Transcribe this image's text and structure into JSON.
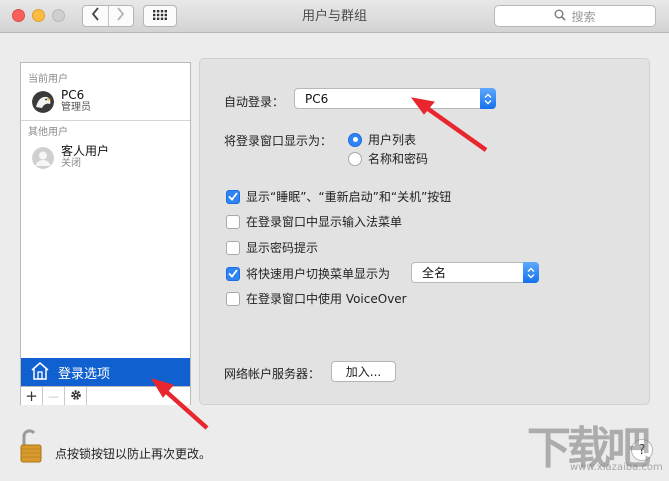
{
  "window": {
    "title": "用户与群组"
  },
  "search": {
    "placeholder": "搜索"
  },
  "icons": {
    "back": "chevron-left-icon",
    "forward": "chevron-right-icon",
    "show_all": "grid-icon",
    "search": "magnifier-icon",
    "lock": "lock-open-icon",
    "help": "help-icon",
    "home": "house-icon",
    "gear": "gear-icon"
  },
  "colors": {
    "selection": "#1061cf",
    "accent": "#2f84f3",
    "annotation_arrow": "#e8262d"
  },
  "sidebar": {
    "current_users_header": "当前用户",
    "current_user": {
      "name": "PC6",
      "role": "管理员"
    },
    "other_users_header": "其他用户",
    "guest_user": {
      "name": "客人用户",
      "status": "关闭"
    },
    "login_options_label": "登录选项",
    "toolbar": {
      "add": "+",
      "remove": "—"
    }
  },
  "panel": {
    "auto_login": {
      "label": "自动登录：",
      "value": "PC6"
    },
    "display_as": {
      "label": "将登录窗口显示为：",
      "options": [
        {
          "label": "用户列表",
          "selected": true
        },
        {
          "label": "名称和密码",
          "selected": false
        }
      ]
    },
    "checkboxes": [
      {
        "label": "显示“睡眠”、“重新启动”和“关机”按钮",
        "checked": true
      },
      {
        "label": "在登录窗口中显示输入法菜单",
        "checked": false
      },
      {
        "label": "显示密码提示",
        "checked": false
      },
      {
        "label": "将快速用户切换菜单显示为",
        "checked": true
      },
      {
        "label": "在登录窗口中使用 VoiceOver",
        "checked": false
      }
    ],
    "fast_switch_value": "全名",
    "network_server": {
      "label": "网络帐户服务器：",
      "button": "加入..."
    }
  },
  "footer": {
    "lock_text": "点按锁按钮以防止再次更改。",
    "help": "?"
  },
  "watermark": {
    "logo": "下载吧",
    "url": "www.xiazaiba.com"
  }
}
